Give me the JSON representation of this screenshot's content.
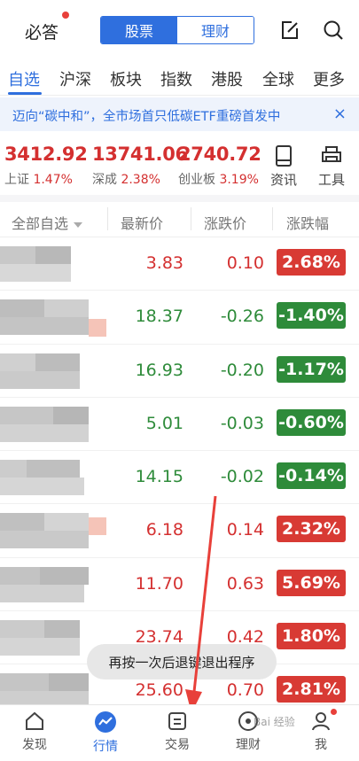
{
  "header": {
    "brand": "必答",
    "seg_tabs": [
      {
        "label": "股票",
        "active": true
      },
      {
        "label": "理财",
        "active": false
      }
    ],
    "icons": [
      "edit-icon",
      "search-icon"
    ]
  },
  "tabs": [
    {
      "label": "自选",
      "active": true
    },
    {
      "label": "沪深",
      "active": false
    },
    {
      "label": "板块",
      "active": false
    },
    {
      "label": "指数",
      "active": false
    },
    {
      "label": "港股",
      "active": false
    },
    {
      "label": "全球",
      "active": false
    },
    {
      "label": "更多",
      "active": false
    }
  ],
  "banner": {
    "text": "迈向“碳中和”，全市场首只低碳ETF重磅首发中",
    "close": "×"
  },
  "indices": [
    {
      "value": "3412.92",
      "name": "上证",
      "pct": "1.47%"
    },
    {
      "value": "13741.06",
      "name": "深成",
      "pct": "2.38%"
    },
    {
      "value": "2740.72",
      "name": "创业板",
      "pct": "3.19%"
    }
  ],
  "tools": [
    {
      "label": "资讯",
      "icon": "phone-news-icon"
    },
    {
      "label": "工具",
      "icon": "printer-tool-icon"
    }
  ],
  "table": {
    "headers": {
      "name": "全部自选",
      "price": "最新价",
      "change": "涨跌价",
      "pct": "涨跌幅"
    },
    "rows": [
      {
        "price": "3.83",
        "change": "0.10",
        "pct": "2.68%",
        "dir": "up"
      },
      {
        "price": "18.37",
        "change": "-0.26",
        "pct": "-1.40%",
        "dir": "down"
      },
      {
        "price": "16.93",
        "change": "-0.20",
        "pct": "-1.17%",
        "dir": "down"
      },
      {
        "price": "5.01",
        "change": "-0.03",
        "pct": "-0.60%",
        "dir": "down"
      },
      {
        "price": "14.15",
        "change": "-0.02",
        "pct": "-0.14%",
        "dir": "down"
      },
      {
        "price": "6.18",
        "change": "0.14",
        "pct": "2.32%",
        "dir": "up"
      },
      {
        "price": "11.70",
        "change": "0.63",
        "pct": "5.69%",
        "dir": "up"
      },
      {
        "price": "23.74",
        "change": "0.42",
        "pct": "1.80%",
        "dir": "up"
      },
      {
        "price": "25.60",
        "change": "0.70",
        "pct": "2.81%",
        "dir": "up"
      }
    ]
  },
  "toast": "再按一次后退键退出程序",
  "bottomnav": [
    {
      "label": "发现",
      "icon": "home-icon",
      "active": false
    },
    {
      "label": "行情",
      "icon": "market-icon",
      "active": true
    },
    {
      "label": "交易",
      "icon": "trade-icon",
      "active": false
    },
    {
      "label": "理财",
      "icon": "finance-icon",
      "active": false
    },
    {
      "label": "我",
      "icon": "user-icon",
      "active": false
    }
  ],
  "watermark": "Bai 经验",
  "colors": {
    "accent": "#2f6fde",
    "up": "#d83a34",
    "down": "#2e8b3a",
    "arrow": "#e8403a"
  }
}
